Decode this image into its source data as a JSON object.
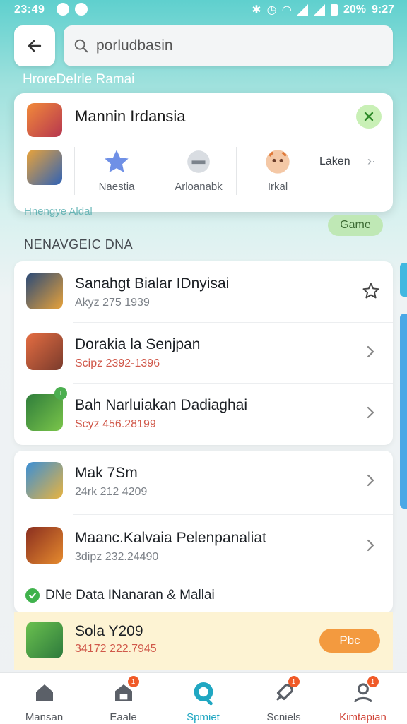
{
  "status_bar": {
    "time": "23:49",
    "battery": "20%",
    "clock": "9:27"
  },
  "search": {
    "value": "porludbasin",
    "placeholder": ""
  },
  "sub_label": "HroreDeIrle Ramai",
  "popup": {
    "title": "Mannin Irdansia",
    "options": [
      {
        "label": "Naestia",
        "icon": "star-icon"
      },
      {
        "label": "Arloanabk",
        "icon": "shield-icon"
      },
      {
        "label": "Irkal",
        "icon": "character-icon"
      }
    ],
    "extra_label": "Laken"
  },
  "faded_label": "Hnengye Aldal",
  "game_pill": "Game",
  "section_title": "NENAVGEIC DNA",
  "list_primary": [
    {
      "name": "Sanahgt Bialar IDnyisai",
      "meta": "Akyz 275 1939",
      "meta_color": "gray",
      "action": "star-icon",
      "colors": [
        "#2a4a78",
        "#e8a23a"
      ]
    },
    {
      "name": "Dorakia la Senjpan",
      "meta": "Scipz 2392-1396",
      "meta_color": "red",
      "action": "chevron-right-icon",
      "colors": [
        "#e46d42",
        "#7a3b2c"
      ]
    },
    {
      "name": "Bah Narluiakan Dadiaghai",
      "meta": "Scyz 456.28199",
      "meta_color": "red",
      "action": "chevron-right-icon",
      "colors": [
        "#2f7d3b",
        "#7ac54a"
      ]
    }
  ],
  "list_secondary": [
    {
      "name": "Mak 7Sm",
      "meta": "24rk 212 4209",
      "meta_color": "gray",
      "action": "chevron-right-icon",
      "colors": [
        "#3b8fd6",
        "#e8b33f"
      ]
    },
    {
      "name": "Maanc.Kalvaia Pelenpanaliat",
      "meta": "3dipz 232.24490",
      "meta_color": "gray",
      "action": "chevron-right-icon",
      "colors": [
        "#8a2e1f",
        "#e58a2e"
      ]
    }
  ],
  "verified_label": "DNe Data INanaran & Mallai",
  "featured": {
    "name": "Sola Y209",
    "meta": "34172 222.7945",
    "button": "Pbc"
  },
  "bottom_nav": [
    {
      "label": "Mansan",
      "icon": "home-icon",
      "badge": ""
    },
    {
      "label": "Eaale",
      "icon": "store-icon",
      "badge": "1"
    },
    {
      "label": "Spmiet",
      "icon": "chat-icon",
      "badge": ""
    },
    {
      "label": "Scniels",
      "icon": "rocket-icon",
      "badge": "1"
    },
    {
      "label": "Kimtapian",
      "icon": "profile-icon",
      "badge": "1"
    }
  ],
  "colors": {
    "accent": "#20a7c2",
    "badge": "#f05a28",
    "pill": "#bfe8b5",
    "button": "#f39a3f"
  }
}
